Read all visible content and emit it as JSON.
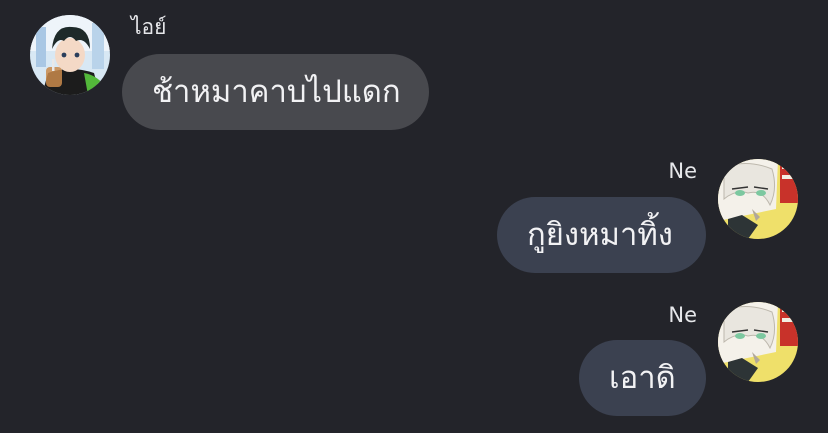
{
  "messages": [
    {
      "direction": "incoming",
      "sender": "ไอย์",
      "avatar_icon": "avatar-anime-boy-icon",
      "text": "ช้าหมาคาบไปแดก"
    },
    {
      "direction": "outgoing",
      "sender": "Ne",
      "avatar_icon": "avatar-anime-white-hair-icon",
      "text": "กูยิงหมาทิ้ง"
    },
    {
      "direction": "outgoing",
      "sender": "Ne",
      "avatar_icon": "avatar-anime-white-hair-icon",
      "text": "เอาดิ"
    }
  ],
  "colors": {
    "background": "#23242a",
    "incoming_bubble": "#48494e",
    "outgoing_bubble": "#3b4150",
    "text": "#f2f2f4"
  }
}
